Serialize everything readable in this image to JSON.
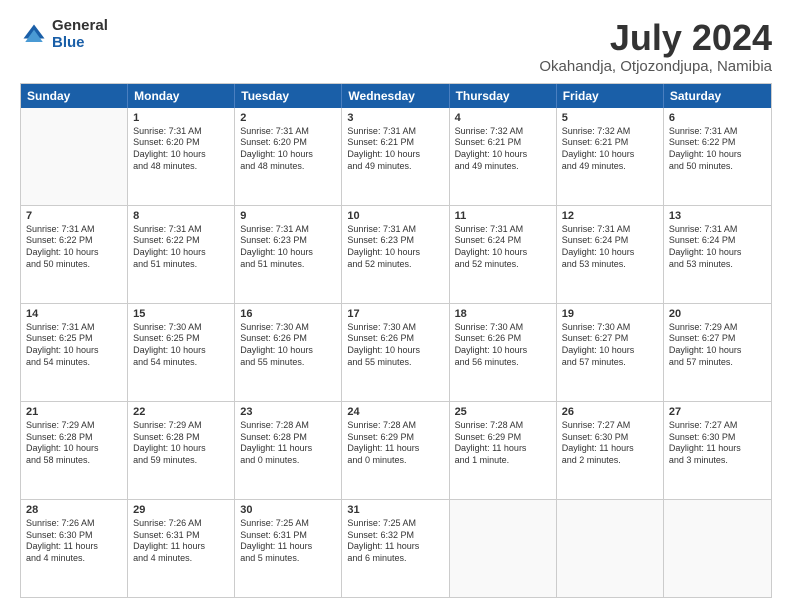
{
  "logo": {
    "general": "General",
    "blue": "Blue"
  },
  "title": "July 2024",
  "location": "Okahandja, Otjozondjupa, Namibia",
  "days": [
    "Sunday",
    "Monday",
    "Tuesday",
    "Wednesday",
    "Thursday",
    "Friday",
    "Saturday"
  ],
  "weeks": [
    [
      {
        "num": "",
        "lines": []
      },
      {
        "num": "1",
        "lines": [
          "Sunrise: 7:31 AM",
          "Sunset: 6:20 PM",
          "Daylight: 10 hours",
          "and 48 minutes."
        ]
      },
      {
        "num": "2",
        "lines": [
          "Sunrise: 7:31 AM",
          "Sunset: 6:20 PM",
          "Daylight: 10 hours",
          "and 48 minutes."
        ]
      },
      {
        "num": "3",
        "lines": [
          "Sunrise: 7:31 AM",
          "Sunset: 6:21 PM",
          "Daylight: 10 hours",
          "and 49 minutes."
        ]
      },
      {
        "num": "4",
        "lines": [
          "Sunrise: 7:32 AM",
          "Sunset: 6:21 PM",
          "Daylight: 10 hours",
          "and 49 minutes."
        ]
      },
      {
        "num": "5",
        "lines": [
          "Sunrise: 7:32 AM",
          "Sunset: 6:21 PM",
          "Daylight: 10 hours",
          "and 49 minutes."
        ]
      },
      {
        "num": "6",
        "lines": [
          "Sunrise: 7:31 AM",
          "Sunset: 6:22 PM",
          "Daylight: 10 hours",
          "and 50 minutes."
        ]
      }
    ],
    [
      {
        "num": "7",
        "lines": [
          "Sunrise: 7:31 AM",
          "Sunset: 6:22 PM",
          "Daylight: 10 hours",
          "and 50 minutes."
        ]
      },
      {
        "num": "8",
        "lines": [
          "Sunrise: 7:31 AM",
          "Sunset: 6:22 PM",
          "Daylight: 10 hours",
          "and 51 minutes."
        ]
      },
      {
        "num": "9",
        "lines": [
          "Sunrise: 7:31 AM",
          "Sunset: 6:23 PM",
          "Daylight: 10 hours",
          "and 51 minutes."
        ]
      },
      {
        "num": "10",
        "lines": [
          "Sunrise: 7:31 AM",
          "Sunset: 6:23 PM",
          "Daylight: 10 hours",
          "and 52 minutes."
        ]
      },
      {
        "num": "11",
        "lines": [
          "Sunrise: 7:31 AM",
          "Sunset: 6:24 PM",
          "Daylight: 10 hours",
          "and 52 minutes."
        ]
      },
      {
        "num": "12",
        "lines": [
          "Sunrise: 7:31 AM",
          "Sunset: 6:24 PM",
          "Daylight: 10 hours",
          "and 53 minutes."
        ]
      },
      {
        "num": "13",
        "lines": [
          "Sunrise: 7:31 AM",
          "Sunset: 6:24 PM",
          "Daylight: 10 hours",
          "and 53 minutes."
        ]
      }
    ],
    [
      {
        "num": "14",
        "lines": [
          "Sunrise: 7:31 AM",
          "Sunset: 6:25 PM",
          "Daylight: 10 hours",
          "and 54 minutes."
        ]
      },
      {
        "num": "15",
        "lines": [
          "Sunrise: 7:30 AM",
          "Sunset: 6:25 PM",
          "Daylight: 10 hours",
          "and 54 minutes."
        ]
      },
      {
        "num": "16",
        "lines": [
          "Sunrise: 7:30 AM",
          "Sunset: 6:26 PM",
          "Daylight: 10 hours",
          "and 55 minutes."
        ]
      },
      {
        "num": "17",
        "lines": [
          "Sunrise: 7:30 AM",
          "Sunset: 6:26 PM",
          "Daylight: 10 hours",
          "and 55 minutes."
        ]
      },
      {
        "num": "18",
        "lines": [
          "Sunrise: 7:30 AM",
          "Sunset: 6:26 PM",
          "Daylight: 10 hours",
          "and 56 minutes."
        ]
      },
      {
        "num": "19",
        "lines": [
          "Sunrise: 7:30 AM",
          "Sunset: 6:27 PM",
          "Daylight: 10 hours",
          "and 57 minutes."
        ]
      },
      {
        "num": "20",
        "lines": [
          "Sunrise: 7:29 AM",
          "Sunset: 6:27 PM",
          "Daylight: 10 hours",
          "and 57 minutes."
        ]
      }
    ],
    [
      {
        "num": "21",
        "lines": [
          "Sunrise: 7:29 AM",
          "Sunset: 6:28 PM",
          "Daylight: 10 hours",
          "and 58 minutes."
        ]
      },
      {
        "num": "22",
        "lines": [
          "Sunrise: 7:29 AM",
          "Sunset: 6:28 PM",
          "Daylight: 10 hours",
          "and 59 minutes."
        ]
      },
      {
        "num": "23",
        "lines": [
          "Sunrise: 7:28 AM",
          "Sunset: 6:28 PM",
          "Daylight: 11 hours",
          "and 0 minutes."
        ]
      },
      {
        "num": "24",
        "lines": [
          "Sunrise: 7:28 AM",
          "Sunset: 6:29 PM",
          "Daylight: 11 hours",
          "and 0 minutes."
        ]
      },
      {
        "num": "25",
        "lines": [
          "Sunrise: 7:28 AM",
          "Sunset: 6:29 PM",
          "Daylight: 11 hours",
          "and 1 minute."
        ]
      },
      {
        "num": "26",
        "lines": [
          "Sunrise: 7:27 AM",
          "Sunset: 6:30 PM",
          "Daylight: 11 hours",
          "and 2 minutes."
        ]
      },
      {
        "num": "27",
        "lines": [
          "Sunrise: 7:27 AM",
          "Sunset: 6:30 PM",
          "Daylight: 11 hours",
          "and 3 minutes."
        ]
      }
    ],
    [
      {
        "num": "28",
        "lines": [
          "Sunrise: 7:26 AM",
          "Sunset: 6:30 PM",
          "Daylight: 11 hours",
          "and 4 minutes."
        ]
      },
      {
        "num": "29",
        "lines": [
          "Sunrise: 7:26 AM",
          "Sunset: 6:31 PM",
          "Daylight: 11 hours",
          "and 4 minutes."
        ]
      },
      {
        "num": "30",
        "lines": [
          "Sunrise: 7:25 AM",
          "Sunset: 6:31 PM",
          "Daylight: 11 hours",
          "and 5 minutes."
        ]
      },
      {
        "num": "31",
        "lines": [
          "Sunrise: 7:25 AM",
          "Sunset: 6:32 PM",
          "Daylight: 11 hours",
          "and 6 minutes."
        ]
      },
      {
        "num": "",
        "lines": []
      },
      {
        "num": "",
        "lines": []
      },
      {
        "num": "",
        "lines": []
      }
    ]
  ]
}
